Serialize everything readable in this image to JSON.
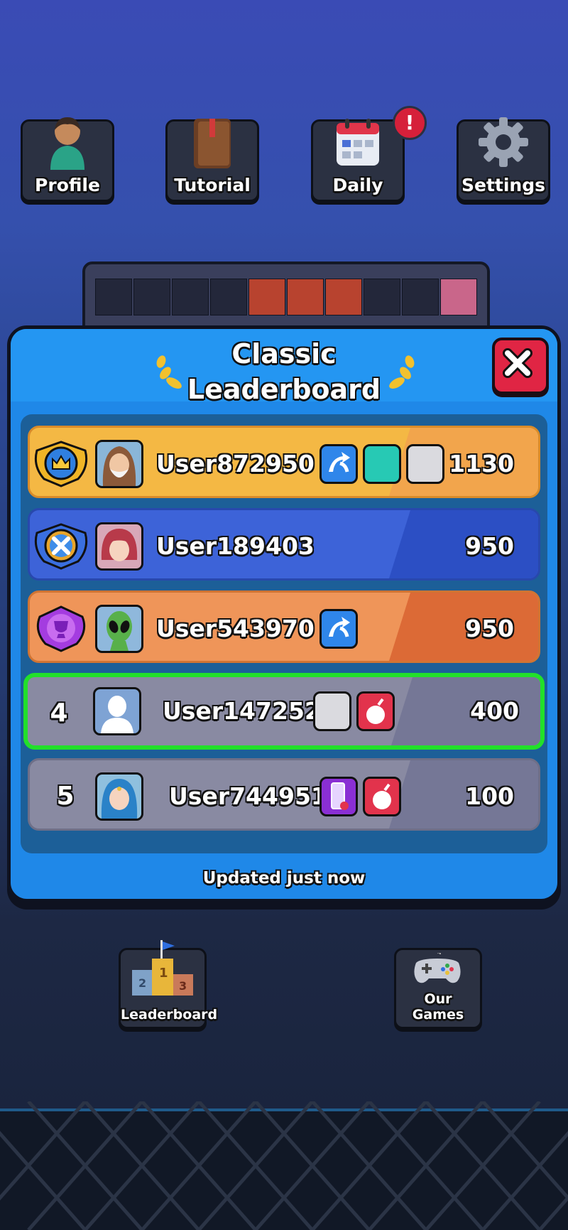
{
  "top_nav": [
    {
      "label": "Profile",
      "icon": "person-icon"
    },
    {
      "label": "Tutorial",
      "icon": "book-icon"
    },
    {
      "label": "Daily",
      "icon": "calendar-icon",
      "badge": "!"
    },
    {
      "label": "Settings",
      "icon": "gear-icon"
    }
  ],
  "leaderboard": {
    "title_line1": "Classic",
    "title_line2": "Leaderboard",
    "close_icon": "close-icon",
    "updated_text": "Updated just now",
    "rows": [
      {
        "rank": "",
        "medal": "gold-crown-medal",
        "avatar": "hooded-old-man-avatar",
        "name": "User872950",
        "score": "1130",
        "items": [
          "swap-arrows-icon",
          "teal-block",
          "grey-block"
        ],
        "bg": "#f4b844",
        "accent": "#f2a54c"
      },
      {
        "rank": "",
        "medal": "silver-x-medal",
        "avatar": "red-hair-avatar",
        "name": "User189403",
        "score": "950",
        "items": [],
        "bg": "#3d63d8",
        "accent": "#2c4fc4"
      },
      {
        "rank": "",
        "medal": "purple-trophy-medal",
        "avatar": "alien-avatar",
        "name": "User543970",
        "score": "950",
        "items": [
          "swap-arrows-icon"
        ],
        "bg": "#ef9559",
        "accent": "#dc6a36"
      },
      {
        "rank": "4",
        "medal": "",
        "avatar": "blank-silhouette-avatar",
        "name": "User147252",
        "score": "400",
        "items": [
          "grey-block",
          "bomb-icon"
        ],
        "bg": "#898aa2",
        "accent": "#757796",
        "highlight": "#22e02a"
      },
      {
        "rank": "5",
        "medal": "",
        "avatar": "blue-hair-girl-avatar",
        "name": "User744951",
        "score": "100",
        "items": [
          "phone-remove-icon",
          "bomb-icon"
        ],
        "bg": "#898aa2",
        "accent": "#757796"
      }
    ]
  },
  "bottom_nav": [
    {
      "label": "Leaderboard",
      "icon": "podium-icon"
    },
    {
      "label": "Our Games",
      "icon": "gamepad-icon"
    }
  ]
}
